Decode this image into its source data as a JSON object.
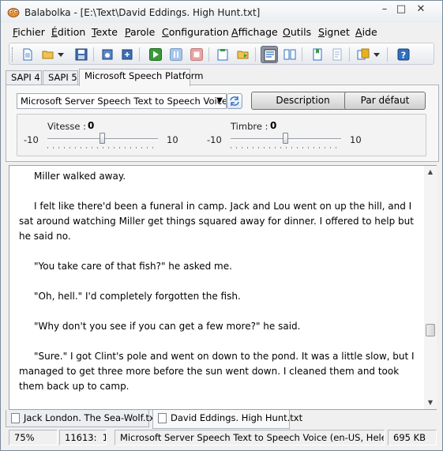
{
  "window": {
    "title": "Balabolka - [E:\\Text\\David Eddings. High Hunt.txt]",
    "min_glyph": "–",
    "max_glyph": "□",
    "close_glyph": "✕"
  },
  "menu": {
    "items": [
      {
        "underline": "F",
        "rest": "ichier"
      },
      {
        "underline": "É",
        "rest": "dition"
      },
      {
        "underline": "T",
        "rest": "exte"
      },
      {
        "underline": "P",
        "rest": "arole"
      },
      {
        "underline": "C",
        "rest": "onfiguration"
      },
      {
        "underline": "A",
        "rest": "ffichage"
      },
      {
        "underline": "O",
        "rest": "utils"
      },
      {
        "underline": "S",
        "rest": "ignet"
      },
      {
        "underline": "A",
        "rest": "ide"
      }
    ]
  },
  "toolbar": {
    "buttons": [
      "new-file-icon",
      "open-folder-icon",
      "dropdown-arrow-icon",
      "save-icon",
      "save-audio-icon",
      "export-icon",
      "play-icon",
      "pause-icon",
      "stop-icon",
      "read-clipboard-icon",
      "read-file-icon",
      "speech-settings-icon",
      "split-icon",
      "bookmark-icon",
      "text-tool-icon",
      "combine-icon",
      "dropdown-arrow-icon",
      "help-icon"
    ],
    "active_button": "speech-settings-icon",
    "accent_colors": {
      "blue": "#2f6fc0",
      "green": "#3a9a3a",
      "red": "#d04040",
      "yellow": "#e8b020"
    }
  },
  "sapi_tabs": {
    "tabs": [
      "SAPI 4",
      "SAPI 5",
      "Microsoft Speech Platform"
    ],
    "active": "Microsoft Speech Platform"
  },
  "voice_panel": {
    "voice_value": "Microsoft Server Speech Text to Speech Voice (en-US, Helen)",
    "description_button": "Description",
    "default_button": "Par défaut",
    "rate": {
      "label": "Vitesse :",
      "value": "0",
      "min": "-10",
      "max": "10",
      "level": 0.5
    },
    "pitch": {
      "label": "Timbre :",
      "value": "0",
      "min": "-10",
      "max": "10",
      "level": 0.5
    }
  },
  "editor": {
    "paragraphs": [
      "Miller walked away.",
      "I felt like there'd been a funeral in camp. Jack and Lou went on up the hill, and I sat around watching Miller get things squared away for dinner. I offered to help but he said no.",
      "\"You take care of that fish?\" he asked me.",
      "\"Oh, hell.\" I'd completely forgotten the fish.",
      "\"Why don't you see if you can get a few more?\" he said.",
      "\"Sure.\" I got Clint's pole and went on down to the pond. It was a little slow, but I managed to get three more before the sun went down. I cleaned them and took them back up to camp."
    ],
    "scroll_up": "▲",
    "scroll_down": "▼",
    "scroll_position": 0.72
  },
  "doc_tabs": {
    "tabs": [
      "Jack London. The Sea-Wolf.txt",
      "David Eddings. High Hunt.txt"
    ],
    "active": "David Eddings. High Hunt.txt"
  },
  "status": {
    "zoom": "75%",
    "position": "11613:",
    "column": "1",
    "voice": "Microsoft Server Speech Text to Speech Voice (en-US, Helen)",
    "size": "695 KB"
  }
}
